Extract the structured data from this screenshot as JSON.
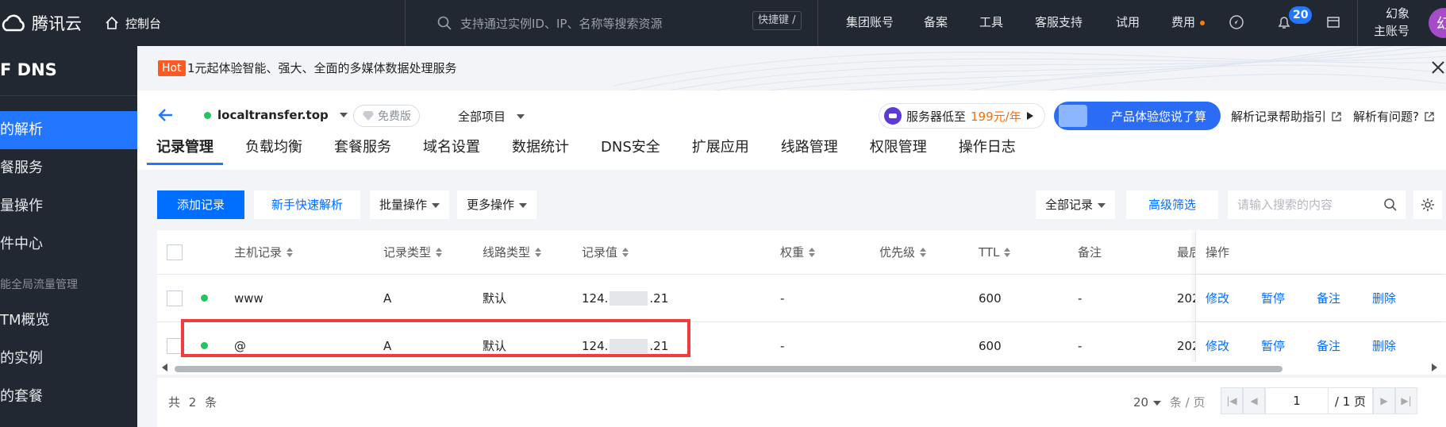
{
  "topbar": {
    "brand": "腾讯云",
    "console": "控制台",
    "search_placeholder": "支持通过实例ID、IP、名称等搜索资源",
    "shortcut": "快捷键 /",
    "nav": [
      "集团账号",
      "备案",
      "工具",
      "客服支持",
      "试用",
      "费用"
    ],
    "notifications": "20",
    "account_line1": "幻象",
    "account_line2": "主账号",
    "avatar": "幻"
  },
  "sidebar": {
    "title": "F DNS",
    "items": [
      "的解析",
      "餐服务",
      "量操作",
      "件中心"
    ],
    "group_label": "能全局流量管理",
    "group_items": [
      "TM概览",
      "的实例",
      "的套餐"
    ]
  },
  "banner": {
    "hot": "Hot",
    "text": "1元起体验智能、强大、全面的多媒体数据处理服务"
  },
  "domain": {
    "name": "localtransfer.top",
    "plan": "免费版",
    "project": "全部项目",
    "promo_text": "服务器低至",
    "promo_price": "199元/年",
    "experience": "产品体验您说了算",
    "help_link": "解析记录帮助指引",
    "question_link": "解析有问题?"
  },
  "tabs": [
    "记录管理",
    "负载均衡",
    "套餐服务",
    "域名设置",
    "数据统计",
    "DNS安全",
    "扩展应用",
    "线路管理",
    "权限管理",
    "操作日志"
  ],
  "toolbar": {
    "add": "添加记录",
    "quick": "新手快速解析",
    "batch": "批量操作",
    "more": "更多操作",
    "filter": "全部记录",
    "advanced": "高级筛选",
    "search_placeholder": "请输入搜索的内容"
  },
  "table": {
    "headers": [
      "主机记录",
      "记录类型",
      "线路类型",
      "记录值",
      "权重",
      "优先级",
      "TTL",
      "备注",
      "最后",
      "操作"
    ],
    "rows": [
      {
        "host": "www",
        "type": "A",
        "line": "默认",
        "value_a": "124.",
        "value_b": ".21",
        "weight": "-",
        "priority": "",
        "ttl": "600",
        "note": "-",
        "updated": "202"
      },
      {
        "host": "@",
        "type": "A",
        "line": "默认",
        "value_a": "124.",
        "value_b": ".21",
        "weight": "-",
        "priority": "",
        "ttl": "600",
        "note": "-",
        "updated": "202"
      }
    ],
    "actions": [
      "修改",
      "暂停",
      "备注",
      "删除"
    ]
  },
  "footer": {
    "total": "共 2 条",
    "page_size": "20",
    "page_size_unit": "条 / 页",
    "page": "1",
    "page_total": "/ 1 页"
  }
}
